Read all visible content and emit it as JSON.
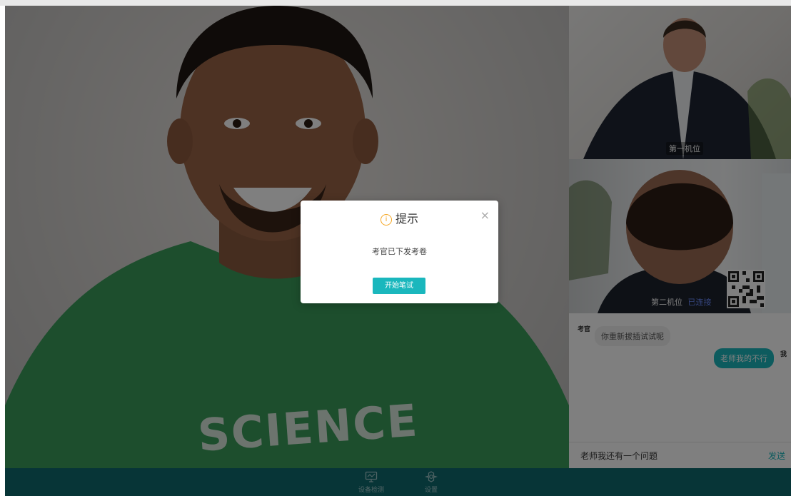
{
  "main_video": {
    "shirt_text": "SCIENCE"
  },
  "side": {
    "camera1": {
      "label": "第一机位"
    },
    "camera2": {
      "label": "第二机位",
      "status": "已连接"
    }
  },
  "chat": {
    "messages": [
      {
        "sender": "考官",
        "text": "你重新拔插试试呢",
        "side": "left"
      },
      {
        "sender": "我",
        "text": "老师我的不行",
        "side": "right"
      }
    ],
    "input_value": "老师我还有一个问题",
    "send_label": "发送"
  },
  "toolbar": {
    "device_check_label": "设备检测",
    "settings_label": "设置"
  },
  "dialog": {
    "title": "提示",
    "message": "考官已下发考卷",
    "button_label": "开始笔试"
  },
  "colors": {
    "accent": "#1ab7bd",
    "bar": "#0f6a6f",
    "warning": "#f5a623"
  }
}
